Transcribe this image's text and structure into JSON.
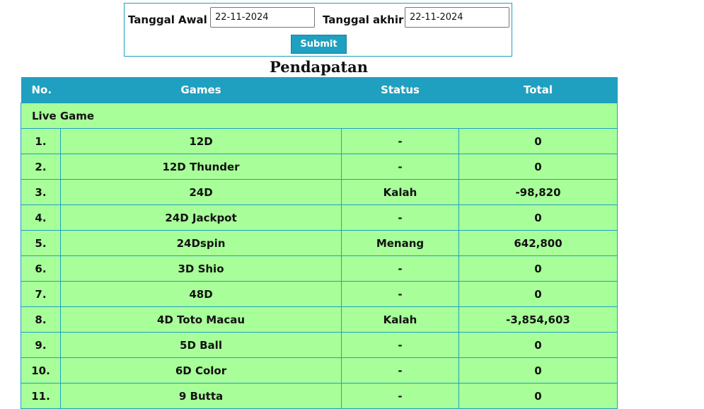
{
  "filter": {
    "start_label": "Tanggal Awal",
    "start_value": "22-11-2024",
    "end_label": "Tanggal akhir",
    "end_value": "22-11-2024",
    "submit_label": "Submit"
  },
  "title": "Pendapatan",
  "table": {
    "headers": [
      "No.",
      "Games",
      "Status",
      "Total"
    ],
    "section": "Live Game",
    "rows": [
      {
        "no": "1.",
        "game": "12D",
        "status": "-",
        "total": "0"
      },
      {
        "no": "2.",
        "game": "12D Thunder",
        "status": "-",
        "total": "0"
      },
      {
        "no": "3.",
        "game": "24D",
        "status": "Kalah",
        "total": "-98,820"
      },
      {
        "no": "4.",
        "game": "24D Jackpot",
        "status": "-",
        "total": "0"
      },
      {
        "no": "5.",
        "game": "24Dspin",
        "status": "Menang",
        "total": "642,800"
      },
      {
        "no": "6.",
        "game": "3D Shio",
        "status": "-",
        "total": "0"
      },
      {
        "no": "7.",
        "game": "48D",
        "status": "-",
        "total": "0"
      },
      {
        "no": "8.",
        "game": "4D Toto Macau",
        "status": "Kalah",
        "total": "-3,854,603"
      },
      {
        "no": "9.",
        "game": "5D Ball",
        "status": "-",
        "total": "0"
      },
      {
        "no": "10.",
        "game": "6D Color",
        "status": "-",
        "total": "0"
      },
      {
        "no": "11.",
        "game": "9 Butta",
        "status": "-",
        "total": "0"
      }
    ]
  },
  "colors": {
    "header_bg": "#1fa0c0",
    "row_bg": "#a8ff99",
    "status_kalah": "#dd0000",
    "status_menang": "#0000dd"
  }
}
